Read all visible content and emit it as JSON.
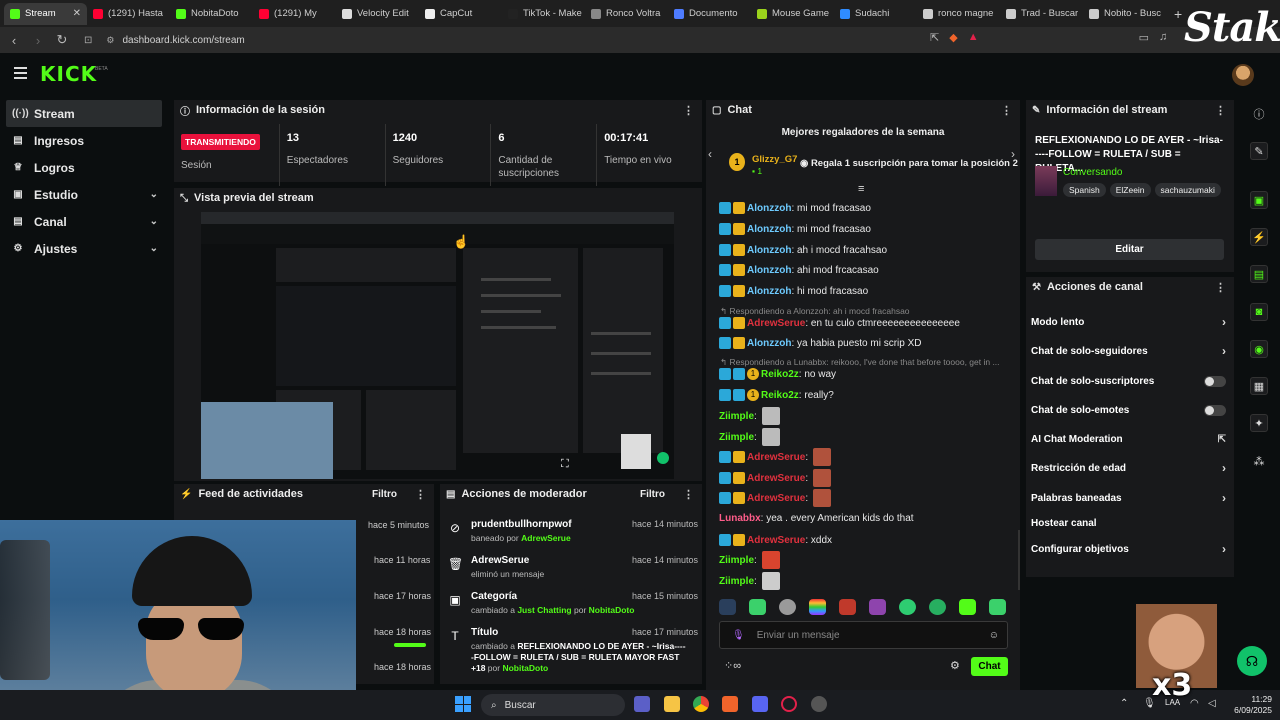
{
  "browser": {
    "tabs": [
      {
        "label": "Stream",
        "color": "#53fc18",
        "active": true
      },
      {
        "label": "(1291) Hasta",
        "color": "#ff0033"
      },
      {
        "label": "NobitaDoto",
        "color": "#53fc18"
      },
      {
        "label": "(1291) My",
        "color": "#ff0033"
      },
      {
        "label": "Velocity Edit",
        "color": "#dddddd"
      },
      {
        "label": "CapCut",
        "color": "#eeeeee"
      },
      {
        "label": "TikTok - Make",
        "color": "#222222"
      },
      {
        "label": "Ronco Voltra",
        "color": "#888888"
      },
      {
        "label": "Documento",
        "color": "#4e7cff"
      },
      {
        "label": "Mouse Game",
        "color": "#9bd31c"
      },
      {
        "label": "Sudachi",
        "color": "#2f8cff"
      },
      {
        "label": "ronco magne",
        "color": "#cccccc"
      },
      {
        "label": "Trad - Buscar",
        "color": "#cccccc"
      },
      {
        "label": "Nobito - Busc",
        "color": "#cccccc"
      }
    ],
    "url": "dashboard.kick.com/stream"
  },
  "brand": {
    "stake": "Stake",
    "kick": "KICK",
    "beta": "BETA",
    "accent": "#53fc18"
  },
  "nav": [
    {
      "label": "Stream",
      "icon": "stream-icon",
      "active": true
    },
    {
      "label": "Ingresos",
      "icon": "revenue-icon"
    },
    {
      "label": "Logros",
      "icon": "trophy-icon"
    },
    {
      "label": "Estudio",
      "icon": "studio-icon",
      "expand": true
    },
    {
      "label": "Canal",
      "icon": "channel-icon",
      "expand": true
    },
    {
      "label": "Ajustes",
      "icon": "gear-icon",
      "expand": true
    }
  ],
  "session": {
    "title": "Información de la sesión",
    "status": "TRANSMITIENDO",
    "status_label": "Sesión",
    "stats": [
      {
        "value": "13",
        "label": "Espectadores"
      },
      {
        "value": "1240",
        "label": "Seguidores"
      },
      {
        "value": "6",
        "label": "Cantidad de suscripciones"
      },
      {
        "value": "00:17:41",
        "label": "Tiempo en vivo"
      }
    ]
  },
  "preview": {
    "title": "Vista previa del stream"
  },
  "feed": {
    "title": "Feed de actividades",
    "filter": "Filtro",
    "times": [
      "hace 5 minutos",
      "hace 11 horas",
      "hace 17 horas",
      "hace 18 horas",
      "hace 18 horas"
    ]
  },
  "mod": {
    "title": "Acciones de moderador",
    "filter": "Filtro",
    "items": [
      {
        "title": "prudentbullhornpwof",
        "pre": "baneado por ",
        "user": "AdrewSerue",
        "time": "hace 14 minutos",
        "icon": "ban-icon"
      },
      {
        "title": "AdrewSerue",
        "pre": "eliminó un mensaje",
        "user": "",
        "time": "hace 14 minutos",
        "icon": "trash-icon"
      },
      {
        "title": "Categoría",
        "pre": "cambiado a ",
        "user": "Just Chatting",
        "mid": " por ",
        "user2": "NobitaDoto",
        "time": "hace 15 minutos",
        "icon": "category-icon"
      },
      {
        "title": "Título",
        "pre": "cambiado a ",
        "user": "REFLEXIONANDO LO DE AYER - ~Irisa-----FOLLOW = RULETA / SUB = RULETA MAYOR FAST +18",
        "mid": "por ",
        "user2": "NobitaDoto",
        "time": "hace 17 minutos",
        "icon": "title-icon"
      }
    ]
  },
  "chat": {
    "title": "Chat",
    "gifters_title": "Mejores regaladores de la semana",
    "top_gifter": "Glizzy_G7",
    "top_gifter_count": "1",
    "rank": "1",
    "gift_prompt": "Regala 1 suscripción para tomar la posición 2",
    "messages": [
      {
        "user": "Alonzzoh",
        "text": "mi mod fracasao"
      },
      {
        "user": "Alonzzoh",
        "text": "mi mod fracasao"
      },
      {
        "user": "Alonzzoh",
        "text": "ah i mocd fracahsao"
      },
      {
        "user": "Alonzzoh",
        "text": "ahi mod frcacasao"
      },
      {
        "user": "Alonzzoh",
        "text": "hi mod fracasao"
      }
    ],
    "reply1": "Respondiendo a Alonzzoh: ah i mocd fracahsao",
    "msg_adrew1": {
      "user": "AdrewSerue",
      "text": "en tu culo ctmreeeeeeeeeeeeeee"
    },
    "msg_alon6": {
      "user": "Alonzzoh",
      "text": "ya habia puesto mi scrip XD"
    },
    "reply2": "Respondiendo a Lunabbx: reikooo, I've done that before toooo, get in ...",
    "msg_reiko1": {
      "user": "Reiko2z",
      "text": "no way",
      "badge_num": "1"
    },
    "msg_reiko2": {
      "user": "Reiko2z",
      "text": "really?",
      "badge_num": "1"
    },
    "ziimple": "Ziimple",
    "adrew": "AdrewSerue",
    "msg_luna": {
      "user": "Lunabbx",
      "text": "yea . every American kids do that"
    },
    "msg_adrew_last": {
      "user": "AdrewSerue",
      "text": "xddx"
    },
    "input_placeholder": "Enviar un mensaje",
    "send": "Chat"
  },
  "stream_info": {
    "title": "Información del stream",
    "stream_title": "REFLEXIONANDO LO DE AYER - ~Irisa-----FOLLOW = RULETA / SUB = RULETA...",
    "category": "Conversando",
    "tags": [
      "Spanish",
      "ElZeein",
      "sachauzumaki"
    ],
    "edit": "Editar"
  },
  "actions": {
    "title": "Acciones de canal",
    "items": [
      {
        "label": "Modo lento",
        "control": "chevron"
      },
      {
        "label": "Chat de solo-seguidores",
        "control": "chevron"
      },
      {
        "label": "Chat de solo-suscriptores",
        "control": "toggle"
      },
      {
        "label": "Chat de solo-emotes",
        "control": "toggle"
      },
      {
        "label": "AI Chat Moderation",
        "control": "external"
      },
      {
        "label": "Restricción de edad",
        "control": "chevron"
      },
      {
        "label": "Palabras baneadas",
        "control": "chevron"
      },
      {
        "label": "Hostear canal",
        "control": "none"
      },
      {
        "label": "Configurar objetivos",
        "control": "chevron"
      }
    ]
  },
  "overlay": {
    "multiplier": "x3"
  },
  "taskbar": {
    "search": "Buscar",
    "lang": "LAA",
    "time": "11:29",
    "date": "6/09/2025"
  }
}
